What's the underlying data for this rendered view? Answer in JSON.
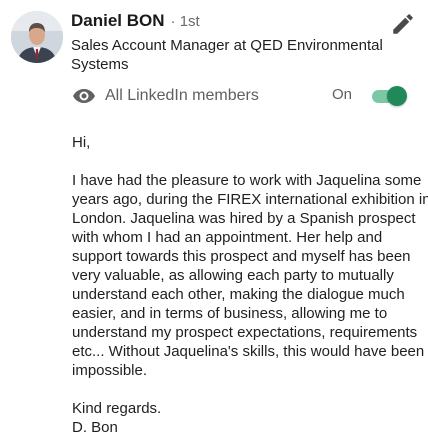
{
  "author": {
    "name": "Daniel BON",
    "degree": "· 1st",
    "headline": "Sales Account Manager at QED Environmental Systems"
  },
  "visibility": {
    "icon": "eye-icon",
    "label": "All LinkedIn members",
    "toggle_label": "On",
    "toggle_on": true,
    "accent_color": "#1f8a57"
  },
  "edit": {
    "icon": "pencil-icon"
  },
  "message": {
    "greeting": "Hi,",
    "body_lines": [
      "I have had the pleasure to work with Jaquelina some",
      "years ago, during the FIREX international exhibition in",
      "London. Jaquelina was hired by a Spanish prospect",
      "with whom I had an appointment. Her help and",
      "support towards this prospect and myself has been",
      "very valuable, as allowing each party to mutually",
      "understand each other, making the dialogue much",
      "easier, and in terms of business, allowing me to",
      "understand my prospect expectations, requirements",
      "etc... Without Jaquelina's skills, this would have been",
      "impossible."
    ],
    "closing": "Kind regards.",
    "signature": "D. Bon"
  }
}
